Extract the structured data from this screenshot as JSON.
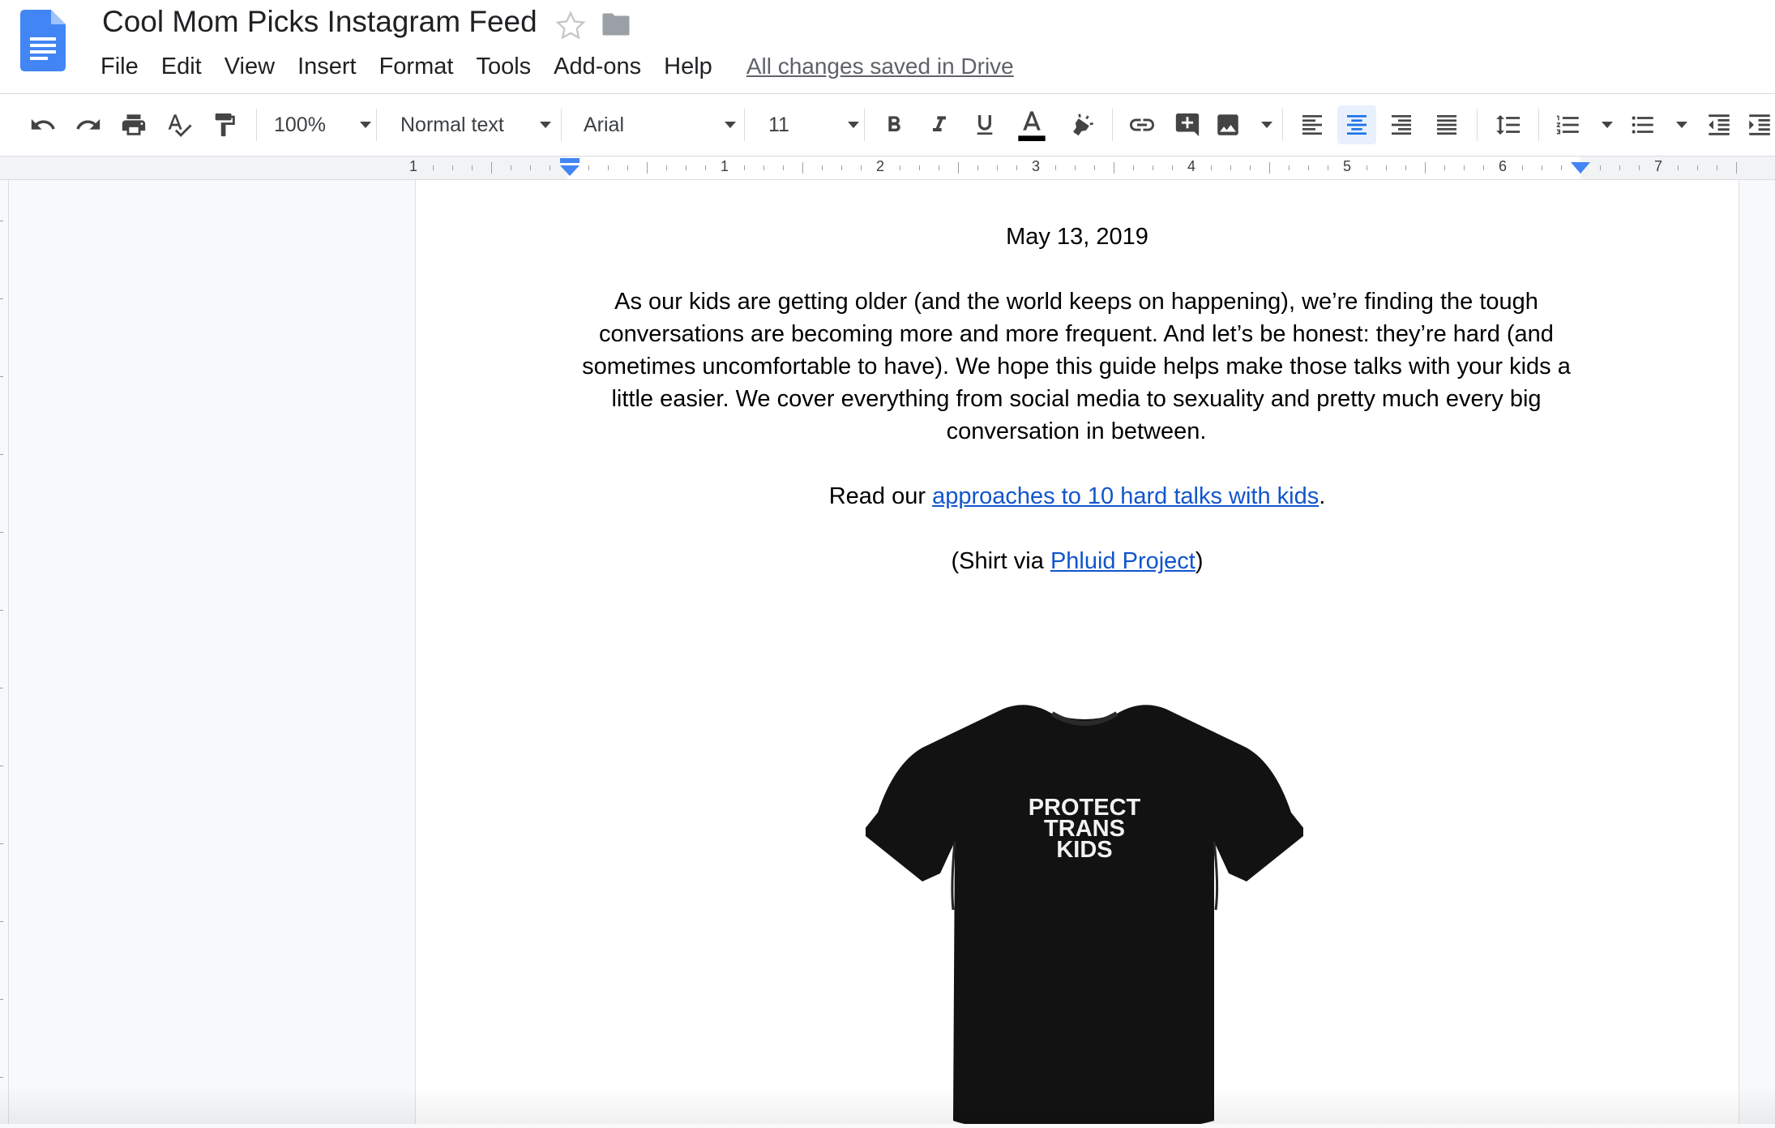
{
  "app": {
    "title": "Cool Mom Picks Instagram Feed",
    "icon": "google-docs-icon",
    "accent_color": "#4285f4"
  },
  "menubar": {
    "items": [
      {
        "label": "File"
      },
      {
        "label": "Edit"
      },
      {
        "label": "View"
      },
      {
        "label": "Insert"
      },
      {
        "label": "Format"
      },
      {
        "label": "Tools"
      },
      {
        "label": "Add-ons"
      },
      {
        "label": "Help"
      }
    ],
    "save_status": "All changes saved in Drive"
  },
  "toolbar": {
    "zoom": "100%",
    "style": "Normal text",
    "font": "Arial",
    "font_size": "11",
    "icons": [
      "undo-icon",
      "redo-icon",
      "print-icon",
      "spellcheck-icon",
      "paint-format-icon",
      "bold-icon",
      "italic-icon",
      "underline-icon",
      "text-color-icon",
      "highlight-icon",
      "link-icon",
      "comment-icon",
      "image-icon",
      "align-left-icon",
      "align-center-icon",
      "align-right-icon",
      "justify-icon",
      "line-spacing-icon",
      "numbered-list-icon",
      "bulleted-list-icon",
      "decrease-indent-icon",
      "increase-indent-icon"
    ],
    "active_alignment": "center"
  },
  "ruler": {
    "labels": [
      "1",
      "1",
      "2",
      "3",
      "4",
      "5",
      "6",
      "7"
    ]
  },
  "document": {
    "date": "May 13, 2019",
    "paragraph": "As our kids are getting older (and the world keeps on happening), we’re finding the tough conversations are becoming more and more frequent. And let’s be honest: they’re hard (and sometimes uncomfortable to have). We hope this guide helps make those talks with your kids a little easier. We cover everything from social media to sexuality and pretty much every big conversation in between.",
    "read_prefix": "Read our ",
    "read_link": "approaches to 10 hard talks with kids",
    "read_suffix": ".",
    "shirt_prefix": "(Shirt via ",
    "shirt_link": "Phluid Project",
    "shirt_suffix": ")",
    "image": {
      "name": "t-shirt-image",
      "text_lines": [
        "PROTECT",
        "TRANS",
        "KIDS"
      ]
    }
  },
  "colors": {
    "link": "#1155cc",
    "active_button_bg": "#e8f0fe",
    "active_button_icon": "#1a73e8"
  }
}
